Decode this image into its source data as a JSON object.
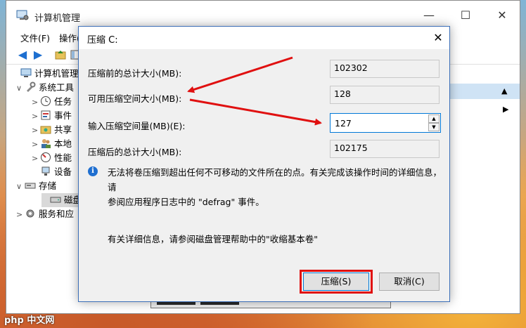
{
  "main_window": {
    "title": "计算机管理",
    "controls": {
      "minimize": "—",
      "maximize": "☐",
      "close": "✕"
    },
    "menu": [
      "文件(F)",
      "操作("
    ],
    "tree": [
      {
        "label": "计算机管理(",
        "chev": "",
        "icon": "computer-icon"
      },
      {
        "label": "系统工具",
        "chev": "∨",
        "icon": "tools-icon"
      },
      {
        "label": "任务",
        "chev": ">",
        "icon": "clock-icon"
      },
      {
        "label": "事件",
        "chev": ">",
        "icon": "event-viewer-icon"
      },
      {
        "label": "共享",
        "chev": ">",
        "icon": "shared-folder-icon"
      },
      {
        "label": "本地",
        "chev": ">",
        "icon": "users-icon"
      },
      {
        "label": "性能",
        "chev": ">",
        "icon": "performance-icon"
      },
      {
        "label": "设备",
        "chev": "",
        "icon": "device-manager-icon"
      },
      {
        "label": "存储",
        "chev": "∨",
        "icon": "storage-icon"
      },
      {
        "label": "磁盘",
        "chev": "",
        "icon": "disk-icon"
      },
      {
        "label": "服务和应",
        "chev": ">",
        "icon": "services-icon"
      }
    ]
  },
  "dialog": {
    "title": "压缩 C:",
    "close": "✕",
    "fields": [
      {
        "label": "压缩前的总计大小(MB):",
        "value": "102302"
      },
      {
        "label": "可用压缩空间大小(MB):",
        "value": "128"
      },
      {
        "label": "输入压缩空间量(MB)(E):",
        "value": "127"
      },
      {
        "label": "压缩后的总计大小(MB):",
        "value": "102175"
      }
    ],
    "info_line1": "无法将卷压缩到超出任何不可移动的文件所在的点。有关完成该操作时间的详细信息，请",
    "info_line2": "参阅应用程序日志中的 \"defrag\" 事件。",
    "detail_text": "有关详细信息，请参阅磁盘管理帮助中的\"收缩基本卷\"",
    "buttons": {
      "shrink": "压缩(S)",
      "cancel": "取消(C)"
    }
  },
  "watermark": "php 中文网",
  "colors": {
    "accent": "#0078d7",
    "highlight_red": "#e01010"
  }
}
